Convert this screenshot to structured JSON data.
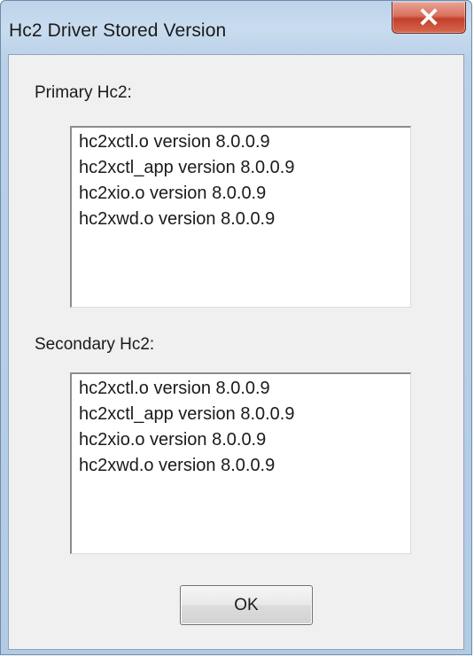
{
  "window": {
    "title": "Hc2 Driver Stored Version",
    "close_icon": "close-icon",
    "close_color": "#c8432e"
  },
  "primary": {
    "label": "Primary Hc2:",
    "items": [
      "hc2xctl.o version 8.0.0.9",
      "hc2xctl_app version 8.0.0.9",
      "hc2xio.o version 8.0.0.9",
      "hc2xwd.o version 8.0.0.9"
    ]
  },
  "secondary": {
    "label": "Secondary Hc2:",
    "items": [
      "hc2xctl.o version 8.0.0.9",
      "hc2xctl_app version 8.0.0.9",
      "hc2xio.o version 8.0.0.9",
      "hc2xwd.o version 8.0.0.9"
    ]
  },
  "buttons": {
    "ok_label": "OK"
  }
}
